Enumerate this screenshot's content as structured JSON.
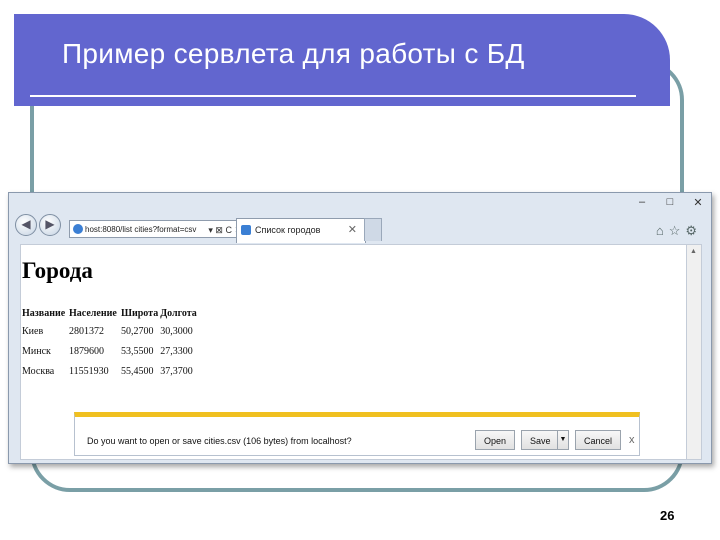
{
  "slide": {
    "title": "Пример сервлета для работы с БД",
    "page_number": "26"
  },
  "browser": {
    "window_controls": [
      "–",
      "□",
      "✕"
    ],
    "address": "host:8080/list cities?format=csv",
    "address_controls": "▾ ⊠ C ✕",
    "tab_label": "Список городов",
    "tab_close": "✕",
    "right_icons": [
      "home-icon",
      "star-icon",
      "gear-icon"
    ]
  },
  "page": {
    "heading": "Города",
    "columns": [
      "Название",
      "Население",
      "Широта",
      "Долгота"
    ],
    "rows": [
      [
        "Киев",
        "2801372",
        "50,2700",
        "30,3000"
      ],
      [
        "Минск",
        "1879600",
        "53,5500",
        "27,3300"
      ],
      [
        "Москва",
        "11551930",
        "55,4500",
        "37,3700"
      ]
    ]
  },
  "download": {
    "message": "Do you want to open or save cities.csv (106 bytes) from localhost?",
    "open_label": "Open",
    "save_label": "Save",
    "cancel_label": "Cancel",
    "close": "x"
  },
  "colors": {
    "title_bar": "#6266cf",
    "frame": "#7a9fa6",
    "notification_accent": "#f0c020"
  }
}
